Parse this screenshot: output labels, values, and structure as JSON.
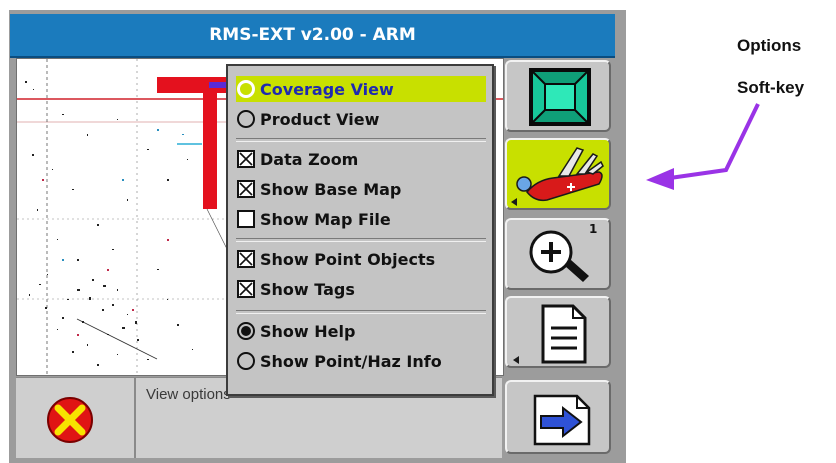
{
  "window": {
    "title": "RMS-EXT v2.00 - ARM"
  },
  "menu": {
    "items": [
      {
        "label": "Coverage View",
        "control": "radio",
        "state": "selected",
        "highlighted": true
      },
      {
        "label": "Product View",
        "control": "radio",
        "state": "unselected"
      },
      {
        "label": "Data Zoom",
        "control": "checkbox",
        "state": "checked"
      },
      {
        "label": "Show Base Map",
        "control": "checkbox",
        "state": "checked"
      },
      {
        "label": "Show Map File",
        "control": "checkbox",
        "state": "unchecked"
      },
      {
        "label": "Show Point Objects",
        "control": "checkbox",
        "state": "checked"
      },
      {
        "label": "Show Tags",
        "control": "checkbox",
        "state": "checked"
      },
      {
        "label": "Show Help",
        "control": "radio",
        "state": "selected"
      },
      {
        "label": "Show Point/Haz Info",
        "control": "radio",
        "state": "unselected"
      }
    ]
  },
  "softkeys": [
    {
      "icon": "frame-view-icon"
    },
    {
      "icon": "swiss-army-knife-icon",
      "active": true
    },
    {
      "icon": "zoom-in-icon",
      "badge": "1"
    },
    {
      "icon": "document-icon"
    }
  ],
  "status": {
    "text": "View options"
  },
  "callout": {
    "line1": "Options",
    "line2": "Soft-key",
    "arrow_color": "#9a33e6"
  },
  "colors": {
    "title_bar": "#1b7bbd",
    "highlight": "#c8e000",
    "highlight_text": "#1f2ab0"
  }
}
